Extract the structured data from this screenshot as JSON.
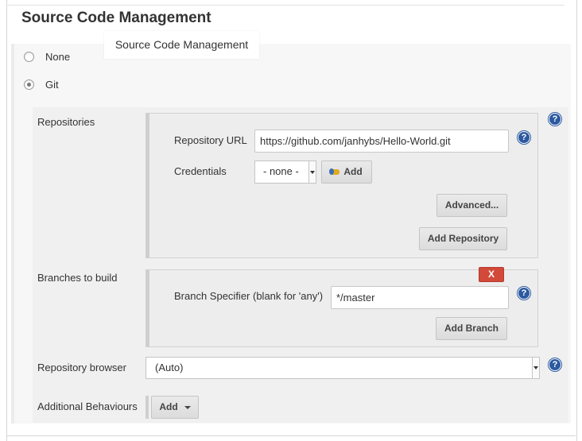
{
  "section": {
    "title": "Source Code Management",
    "tooltip": "Source Code Management"
  },
  "scm_options": [
    {
      "label": "None",
      "checked": false
    },
    {
      "label": "Git",
      "checked": true
    }
  ],
  "repositories": {
    "label": "Repositories",
    "url_label": "Repository URL",
    "url_value": "https://github.com/janhybs/Hello-World.git",
    "credentials_label": "Credentials",
    "credentials_selected": "- none -",
    "add_credentials_label": "Add",
    "advanced_label": "Advanced...",
    "add_repository_label": "Add Repository"
  },
  "branches": {
    "label": "Branches to build",
    "delete_label": "X",
    "specifier_label": "Branch Specifier (blank for 'any')",
    "specifier_value": "*/master",
    "add_branch_label": "Add Branch"
  },
  "browser": {
    "label": "Repository browser",
    "selected": "(Auto)"
  },
  "behaviours": {
    "label": "Additional Behaviours",
    "add_label": "Add"
  },
  "help_glyph": "?",
  "colors": {
    "help": "#2c5aa0",
    "delete": "#d24939",
    "key_icon": "#e0a91f"
  }
}
